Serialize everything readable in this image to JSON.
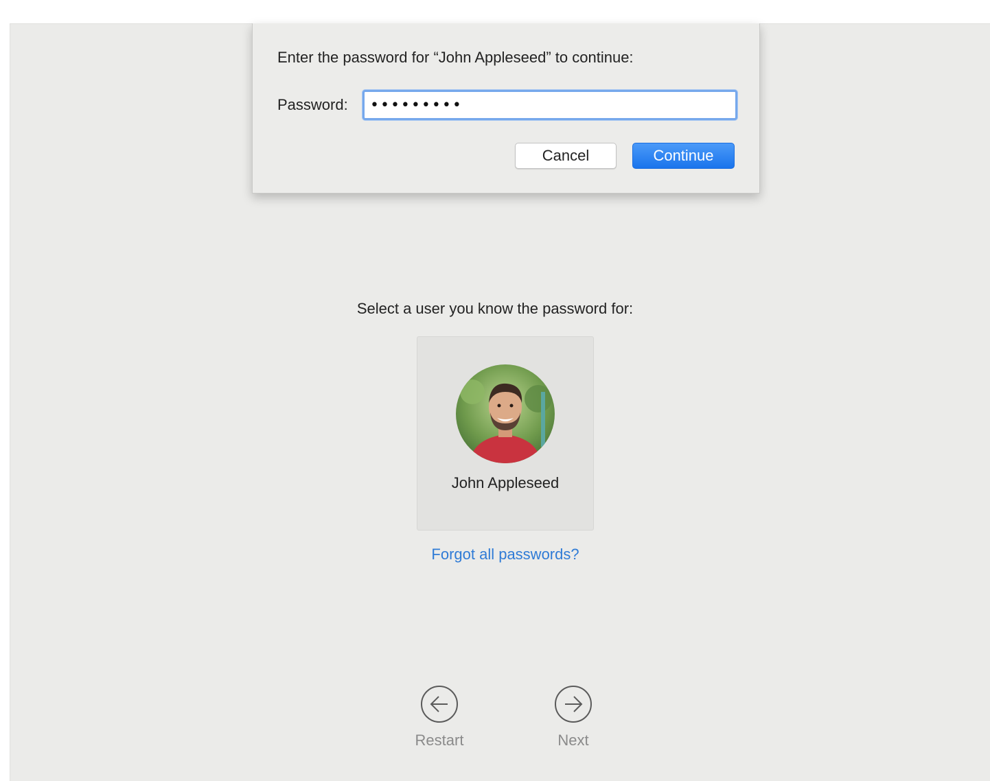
{
  "sheet": {
    "prompt": "Enter the password for “John Appleseed” to continue:",
    "password_label": "Password:",
    "password_value": "•••••••••",
    "cancel_label": "Cancel",
    "continue_label": "Continue"
  },
  "main": {
    "heading": "Select a user you know the password for:",
    "users": [
      {
        "name": "John Appleseed",
        "avatar": "user-photo"
      }
    ],
    "forgot_link": "Forgot all passwords?"
  },
  "nav": {
    "restart_label": "Restart",
    "restart_icon": "arrow-left-circle-icon",
    "next_label": "Next",
    "next_icon": "arrow-right-circle-icon"
  },
  "colors": {
    "background": "#ebebe9",
    "accent": "#1a74ec",
    "link": "#2f7bd6",
    "focus_ring": "#76a8ec"
  }
}
